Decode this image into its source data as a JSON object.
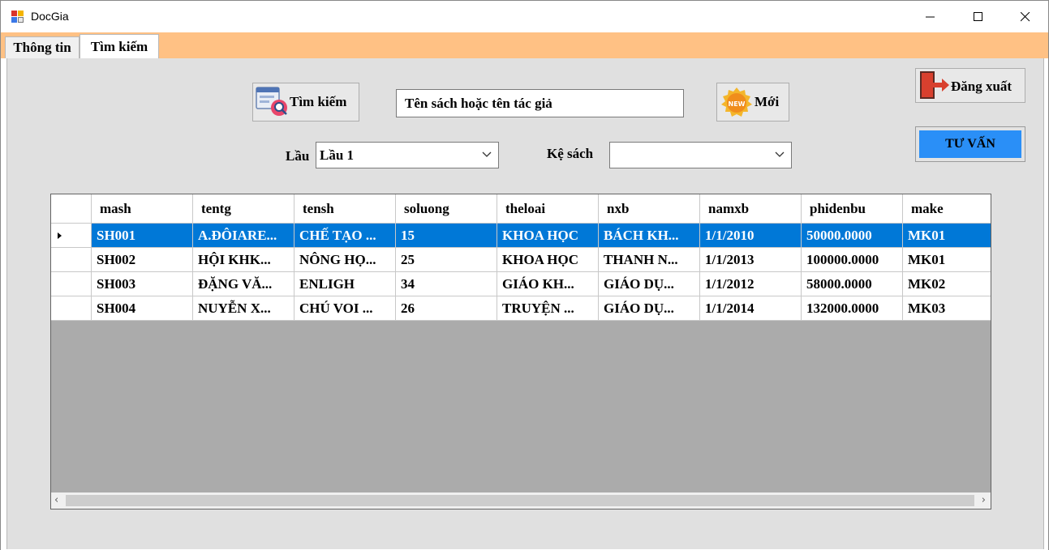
{
  "window": {
    "title": "DocGia"
  },
  "tabs": [
    {
      "label": "Thông tin"
    },
    {
      "label": "Tìm kiếm"
    }
  ],
  "search": {
    "button_label": "Tìm kiếm",
    "input_value": "Tên sách hoặc tên tác giả",
    "new_label": "Mới",
    "new_icon_text": "NEW"
  },
  "filters": {
    "floor_label": "Lầu",
    "floor_value": "Lầu 1",
    "shelf_label": "Kệ sách",
    "shelf_value": ""
  },
  "actions": {
    "logout_label": "Đăng xuất",
    "advise_label": "TƯ VẤN"
  },
  "table": {
    "columns": [
      "mash",
      "tentg",
      "tensh",
      "soluong",
      "theloai",
      "nxb",
      "namxb",
      "phidenbu",
      "make"
    ],
    "rows": [
      [
        "SH001",
        "A.ĐÔIARE...",
        "CHẾ TẠO ...",
        "15",
        "KHOA HỌC",
        "BÁCH KH...",
        "1/1/2010",
        "50000.0000",
        "MK01"
      ],
      [
        "SH002",
        "HỘI KHK...",
        "NÔNG HỌ...",
        "25",
        "KHOA HỌC",
        "THANH N...",
        "1/1/2013",
        "100000.0000",
        "MK01"
      ],
      [
        "SH003",
        "ĐẶNG VĂ...",
        "ENLIGH",
        "34",
        "GIÁO KH...",
        "GIÁO DỤ...",
        "1/1/2012",
        "58000.0000",
        "MK02"
      ],
      [
        "SH004",
        "NUYỄN X...",
        "CHÚ VOI ...",
        "26",
        "TRUYỆN ...",
        "GIÁO DỤ...",
        "1/1/2014",
        "132000.0000",
        "MK03"
      ]
    ],
    "selected_row": 0
  },
  "colors": {
    "tabstrip": "#ffc184",
    "panel": "#e0e0e0",
    "selection": "#0078d7",
    "advise_button": "#2a8ff7",
    "grid_empty": "#ababab"
  },
  "icons": {
    "search": "search-document-icon",
    "new": "new-badge-icon",
    "logout": "exit-door-icon"
  }
}
